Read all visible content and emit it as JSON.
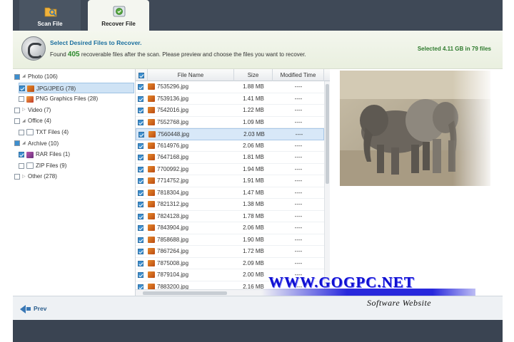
{
  "tabs": [
    {
      "label": "Scan File",
      "icon": "folder-search-icon"
    },
    {
      "label": "Recover File",
      "icon": "recover-disk-icon"
    }
  ],
  "header": {
    "title": "Select Desired Files to Recover.",
    "found_prefix": "Found",
    "found_count": "405",
    "found_suffix": "recoverable files after the scan. Please preview and choose the files you want to recover.",
    "selected": "Selected 4.11 GB in 79 files"
  },
  "tree": [
    {
      "label": "Photo (106)",
      "check": "partial",
      "expanded": true,
      "indent": 0,
      "icon": ""
    },
    {
      "label": "JPG/JPEG (78)",
      "check": "on",
      "indent": 1,
      "icon": "jpg",
      "selected": true
    },
    {
      "label": "PNG Graphics Files (28)",
      "check": "off",
      "indent": 1,
      "icon": "png"
    },
    {
      "label": "Video (7)",
      "check": "off",
      "expanded": false,
      "indent": 0,
      "icon": ""
    },
    {
      "label": "Office (4)",
      "check": "off",
      "expanded": true,
      "indent": 0,
      "icon": ""
    },
    {
      "label": "TXT Files (4)",
      "check": "off",
      "indent": 1,
      "icon": "txt"
    },
    {
      "label": "Archive (10)",
      "check": "partial",
      "expanded": true,
      "indent": 0,
      "icon": ""
    },
    {
      "label": "RAR Files (1)",
      "check": "on",
      "indent": 1,
      "icon": "rar"
    },
    {
      "label": "ZIP Files (9)",
      "check": "off",
      "indent": 1,
      "icon": "zip"
    },
    {
      "label": "Other (278)",
      "check": "off",
      "expanded": false,
      "indent": 0,
      "icon": ""
    }
  ],
  "list": {
    "columns": [
      "File Name",
      "Size",
      "Modified Time"
    ],
    "rows": [
      {
        "name": "7535296.jpg",
        "size": "1.88 MB",
        "time": "----"
      },
      {
        "name": "7539136.jpg",
        "size": "1.41 MB",
        "time": "----"
      },
      {
        "name": "7542016.jpg",
        "size": "1.22 MB",
        "time": "----"
      },
      {
        "name": "7552768.jpg",
        "size": "1.09 MB",
        "time": "----"
      },
      {
        "name": "7560448.jpg",
        "size": "2.03 MB",
        "time": "----",
        "selected": true
      },
      {
        "name": "7614976.jpg",
        "size": "2.06 MB",
        "time": "----"
      },
      {
        "name": "7647168.jpg",
        "size": "1.81 MB",
        "time": "----"
      },
      {
        "name": "7700992.jpg",
        "size": "1.94 MB",
        "time": "----"
      },
      {
        "name": "7714752.jpg",
        "size": "1.91 MB",
        "time": "----"
      },
      {
        "name": "7818304.jpg",
        "size": "1.47 MB",
        "time": "----"
      },
      {
        "name": "7821312.jpg",
        "size": "1.38 MB",
        "time": "----"
      },
      {
        "name": "7824128.jpg",
        "size": "1.78 MB",
        "time": "----"
      },
      {
        "name": "7843904.jpg",
        "size": "2.06 MB",
        "time": "----"
      },
      {
        "name": "7858688.jpg",
        "size": "1.90 MB",
        "time": "----"
      },
      {
        "name": "7867264.jpg",
        "size": "1.72 MB",
        "time": "----"
      },
      {
        "name": "7875008.jpg",
        "size": "2.09 MB",
        "time": "----"
      },
      {
        "name": "7879104.jpg",
        "size": "2.00 MB",
        "time": "----"
      },
      {
        "name": "7883200.jpg",
        "size": "2.16 MB",
        "time": "----"
      }
    ]
  },
  "footer": {
    "prev_label": "Prev"
  },
  "watermark": {
    "url": "WWW.GOGPC.NET",
    "subtitle": "Software Website"
  }
}
